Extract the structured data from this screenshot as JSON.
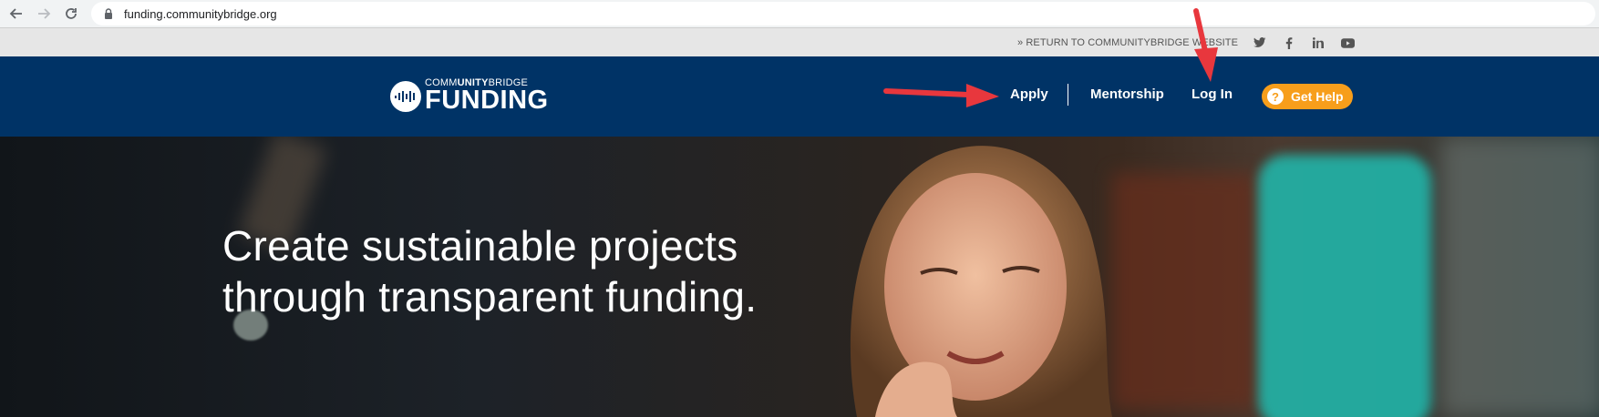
{
  "browser": {
    "url": "funding.communitybridge.org",
    "icons": [
      "back-icon",
      "forward-icon",
      "reload-icon",
      "lock-icon"
    ]
  },
  "utility": {
    "return_link": "» RETURN TO COMMUNITYBRIDGE WEBSITE",
    "social": [
      "twitter-icon",
      "facebook-icon",
      "linkedin-icon",
      "youtube-icon"
    ]
  },
  "header": {
    "logo_small_prefix": "COMM",
    "logo_small_bold": "UNITY",
    "logo_small_suffix": "BRIDGE",
    "logo_big": "FUNDING",
    "nav": {
      "apply": "Apply",
      "mentorship": "Mentorship",
      "login": "Log In"
    },
    "help_icon": "?",
    "help_label": "Get Help"
  },
  "hero": {
    "line1": "Create sustainable projects",
    "line2": "through transparent funding."
  },
  "colors": {
    "header_bg": "#003366",
    "help_button": "#f79e1b",
    "annotation_arrow": "#e8373d"
  }
}
